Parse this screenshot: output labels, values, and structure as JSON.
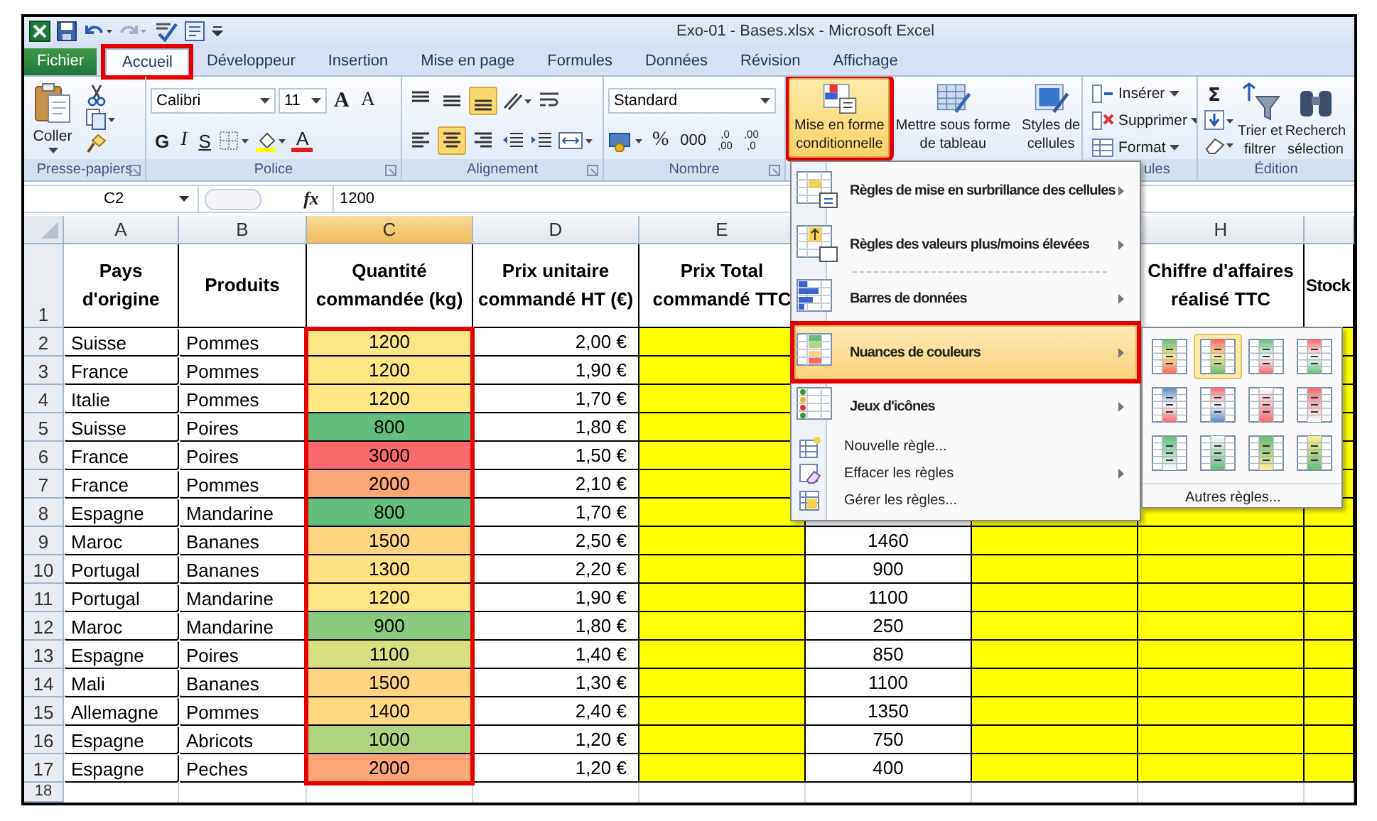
{
  "window": {
    "title": "Exo-01 - Bases.xlsx - Microsoft Excel"
  },
  "tabs": [
    {
      "label": "Fichier",
      "kind": "file",
      "selected": false,
      "outlined": false
    },
    {
      "label": "Accueil",
      "kind": "tab",
      "selected": true,
      "outlined": true
    },
    {
      "label": "Développeur",
      "kind": "tab",
      "selected": false,
      "outlined": false
    },
    {
      "label": "Insertion",
      "kind": "tab",
      "selected": false,
      "outlined": false
    },
    {
      "label": "Mise en page",
      "kind": "tab",
      "selected": false,
      "outlined": false
    },
    {
      "label": "Formules",
      "kind": "tab",
      "selected": false,
      "outlined": false
    },
    {
      "label": "Données",
      "kind": "tab",
      "selected": false,
      "outlined": false
    },
    {
      "label": "Révision",
      "kind": "tab",
      "selected": false,
      "outlined": false
    },
    {
      "label": "Affichage",
      "kind": "tab",
      "selected": false,
      "outlined": false
    }
  ],
  "ribbon": {
    "clipboard": {
      "label": "Presse-papiers",
      "paste": "Coller"
    },
    "font": {
      "label": "Police",
      "font_name": "Calibri",
      "font_size": "11",
      "grow": "A",
      "shrink": "A",
      "bold": "G",
      "italic": "I",
      "underline": "S",
      "font_color": "A"
    },
    "alignment": {
      "label": "Alignement",
      "vertical_options": [
        {
          "selected": false
        },
        {
          "selected": false
        },
        {
          "selected": true
        }
      ],
      "horizontal_options": [
        {
          "selected": false
        },
        {
          "selected": true
        },
        {
          "selected": false
        }
      ]
    },
    "number": {
      "label": "Nombre",
      "format": "Standard",
      "percent": "%",
      "thousands": "000",
      "add_decimal": [
        ",0",
        ",00"
      ],
      "remove_decimal": [
        ",00",
        ",0"
      ]
    },
    "styles": {
      "buttons": [
        {
          "kind": "conditional",
          "lines": [
            "Mise en forme",
            "conditionnelle"
          ],
          "selected": true,
          "outlined": true
        },
        {
          "kind": "table",
          "lines": [
            "Mettre sous forme",
            "de tableau"
          ],
          "selected": false,
          "outlined": false
        },
        {
          "kind": "cell_styles",
          "lines": [
            "Styles de",
            "cellules"
          ],
          "selected": false,
          "outlined": false
        }
      ]
    },
    "cells": {
      "label": "ules",
      "buttons": [
        {
          "kind": "insert",
          "label": "Insérer"
        },
        {
          "kind": "delete",
          "label": "Supprimer"
        },
        {
          "kind": "format",
          "label": "Format"
        }
      ]
    },
    "editing": {
      "label": "Édition",
      "sum": "Σ",
      "sort": [
        "Trier et",
        "filtrer"
      ],
      "find": [
        "Recherch",
        "sélection"
      ]
    }
  },
  "formula_bar": {
    "name_box": "C2",
    "function_label": "fx",
    "value": "1200"
  },
  "sheet": {
    "header_row_number": "1",
    "last_row_number": "18",
    "columns": [
      {
        "letter": "A",
        "header": [
          "Pays",
          "d'origine"
        ],
        "highlighted": false,
        "outlined": false
      },
      {
        "letter": "B",
        "header": [
          "Produits"
        ],
        "highlighted": false,
        "outlined": false
      },
      {
        "letter": "C",
        "header": [
          "Quantité",
          "commandée (kg)"
        ],
        "highlighted": false,
        "outlined": true
      },
      {
        "letter": "D",
        "header": [
          "Prix unitaire",
          "commandé HT (€)"
        ],
        "highlighted": false,
        "outlined": false
      },
      {
        "letter": "E",
        "header": [
          "Prix Total",
          "commandé TTC"
        ],
        "highlighted": true,
        "outlined": false
      },
      {
        "highlighted": false,
        "outlined": false
      },
      {
        "highlighted": true,
        "outlined": false
      },
      {
        "letter": "H",
        "header": [
          "Chiffre d'affaires",
          "réalisé TTC"
        ],
        "highlighted": true,
        "outlined": false
      },
      {
        "header": [
          "Stock"
        ],
        "highlighted": true,
        "outlined": false
      }
    ],
    "rows": [
      {
        "number": "2",
        "country": "Suisse",
        "product": "Pommes",
        "quantity": "1200",
        "color": "#fee685",
        "unit_price": "2,00 €"
      },
      {
        "number": "3",
        "country": "France",
        "product": "Pommes",
        "quantity": "1200",
        "color": "#fee685",
        "unit_price": "1,90 €"
      },
      {
        "number": "4",
        "country": "Italie",
        "product": "Pommes",
        "quantity": "1200",
        "color": "#fee685",
        "unit_price": "1,70 €"
      },
      {
        "number": "5",
        "country": "Suisse",
        "product": "Poires",
        "quantity": "800",
        "color": "#63be7b",
        "unit_price": "1,80 €"
      },
      {
        "number": "6",
        "country": "France",
        "product": "Poires",
        "quantity": "3000",
        "color": "#f8696b",
        "unit_price": "1,50 €"
      },
      {
        "number": "7",
        "country": "France",
        "product": "Pommes",
        "quantity": "2000",
        "color": "#fba676",
        "unit_price": "2,10 €"
      },
      {
        "number": "8",
        "country": "Espagne",
        "product": "Mandarine",
        "quantity": "800",
        "color": "#63be7b",
        "unit_price": "1,70 €"
      },
      {
        "number": "9",
        "country": "Maroc",
        "product": "Bananes",
        "quantity": "1500",
        "color": "#fed480",
        "unit_price": "2,50 €",
        "column_6": "1460"
      },
      {
        "number": "10",
        "country": "Portugal",
        "product": "Bananes",
        "quantity": "1300",
        "color": "#fee182",
        "unit_price": "2,20 €",
        "column_6": "900"
      },
      {
        "number": "11",
        "country": "Portugal",
        "product": "Mandarine",
        "quantity": "1200",
        "color": "#fee685",
        "unit_price": "1,90 €",
        "column_6": "1100"
      },
      {
        "number": "12",
        "country": "Maroc",
        "product": "Mandarine",
        "quantity": "900",
        "color": "#8aca7e",
        "unit_price": "1,80 €",
        "column_6": "250"
      },
      {
        "number": "13",
        "country": "Espagne",
        "product": "Poires",
        "quantity": "1100",
        "color": "#d8df81",
        "unit_price": "1,40 €",
        "column_6": "850"
      },
      {
        "number": "14",
        "country": "Mali",
        "product": "Bananes",
        "quantity": "1500",
        "color": "#fed480",
        "unit_price": "1,30 €",
        "column_6": "1100"
      },
      {
        "number": "15",
        "country": "Allemagne",
        "product": "Pommes",
        "quantity": "1400",
        "color": "#fed981",
        "unit_price": "2,40 €",
        "column_6": "1350"
      },
      {
        "number": "16",
        "country": "Espagne",
        "product": "Abricots",
        "quantity": "1000",
        "color": "#afd47f",
        "unit_price": "1,20 €",
        "column_6": "750"
      },
      {
        "number": "17",
        "country": "Espagne",
        "product": "Peches",
        "quantity": "2000",
        "color": "#fba676",
        "unit_price": "1,20 €",
        "column_6": "400"
      }
    ]
  },
  "conditional_format_menu": {
    "items": [
      {
        "kind": "large",
        "label": "Règles de mise en surbrillance des cellules",
        "submenu": true,
        "divider_above": false,
        "selected": false,
        "outlined": false
      },
      {
        "kind": "large",
        "label": "Règles des valeurs plus/moins élevées",
        "submenu": true,
        "divider_above": false,
        "selected": false,
        "outlined": false
      },
      {
        "kind": "large",
        "label": "Barres de données",
        "submenu": true,
        "divider_above": true,
        "selected": false,
        "outlined": false
      },
      {
        "kind": "large",
        "label": "Nuances de couleurs",
        "submenu": true,
        "divider_above": false,
        "selected": true,
        "outlined": true
      },
      {
        "kind": "large",
        "label": "Jeux d'icônes",
        "submenu": true,
        "divider_above": false,
        "selected": false,
        "outlined": false
      },
      {
        "kind": "small",
        "label": "Nouvelle règle...",
        "submenu": false,
        "divider_above": false,
        "selected": false,
        "outlined": false
      },
      {
        "kind": "small",
        "label": "Effacer les règles",
        "submenu": true,
        "divider_above": false,
        "selected": false,
        "outlined": false
      },
      {
        "kind": "small",
        "label": "Gérer les règles...",
        "submenu": false,
        "divider_above": false,
        "selected": false,
        "outlined": false
      }
    ]
  },
  "color_scale_menu": {
    "swatches": [
      {
        "selected": false
      },
      {
        "selected": true
      },
      {
        "selected": false
      },
      {
        "selected": false
      },
      {
        "selected": false
      },
      {
        "selected": false
      },
      {
        "selected": false
      },
      {
        "selected": false
      },
      {
        "selected": false
      },
      {
        "selected": false
      },
      {
        "selected": false
      },
      {
        "selected": false
      }
    ],
    "more": "Autres règles..."
  }
}
